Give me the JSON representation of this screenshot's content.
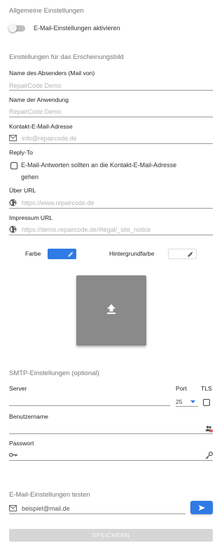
{
  "general": {
    "title": "Allgemeine Einstellungen",
    "toggle_label": "E-Mail-Einstellungen aktivieren",
    "toggle_on": false
  },
  "appearance": {
    "title": "Einstellungen für das Erscheinungsbild",
    "sender_name": {
      "label": "Name des Absenders (Mail von)",
      "placeholder": "RepairCode Demo"
    },
    "app_name": {
      "label": "Name der Anwendung",
      "placeholder": "RepairCode Demo"
    },
    "contact_email": {
      "label": "Kontakt-E-Mail-Adresse",
      "placeholder": "info@repaircode.de",
      "icon": "mail-icon"
    },
    "reply_to": {
      "label": "Reply-To",
      "checkbox_line1": "E-Mail-Antworten sollten an die Kontakt-E-Mail-Adresse",
      "checkbox_line2": "gehen",
      "checked": false
    },
    "about_url": {
      "label": "Über URL",
      "placeholder": "https://www.repaircode.de",
      "icon": "globe-icon"
    },
    "imprint_url": {
      "label": "Impressum URL",
      "placeholder": "https://demo.repaircode.de/#legal/_site_notice",
      "icon": "globe-icon"
    },
    "color": {
      "label": "Farbe",
      "value": "#2f7ae5"
    },
    "bg_color": {
      "label": "Hintergrundfarbe",
      "value": "#ffffff"
    },
    "upload_icon": "upload-icon"
  },
  "smtp": {
    "title": "SMTP-Einstellungen (optional)",
    "server_label": "Server",
    "port_label": "Port",
    "port_value": "25",
    "tls_label": "TLS",
    "tls_checked": false,
    "username_label": "Benutzername",
    "password_label": "Passwort"
  },
  "test": {
    "title": "E-Mail-Einstellungen testen",
    "email_placeholder": "beispiel@mail.de",
    "send_icon": "send-icon"
  },
  "save_label": "SPEICHERN",
  "colors": {
    "accent": "#2f7ae5",
    "save_disabled": "#d6d6d6",
    "upload_bg": "#8a8a8a"
  }
}
